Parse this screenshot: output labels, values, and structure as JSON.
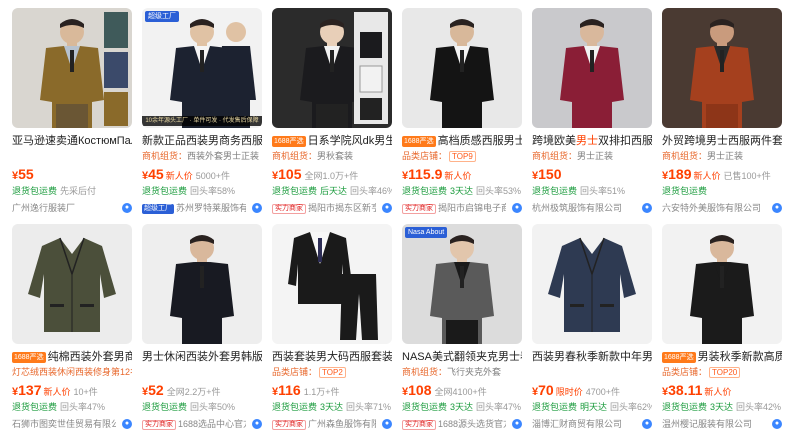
{
  "colors": {
    "price": "#ff4000",
    "green_tag": "#1a9b3c",
    "shop": "#888888",
    "accent_badge": "#ff7a1a"
  },
  "products": [
    {
      "chip": "",
      "title": "亚马逊速卖通КостюмПаль",
      "highlight": "",
      "title2": "",
      "sub_label": "",
      "sub_value": "",
      "sub_top": "",
      "price": "55",
      "newp": "",
      "sold": "",
      "tags": [
        "退货包运费"
      ],
      "repurchase": "先采后付",
      "shop_badge": "",
      "shop": "广州逸行服装厂",
      "img_top": "",
      "img_strip": ""
    },
    {
      "chip": "",
      "title": "新款正品西装男商务西服外",
      "highlight": "",
      "title2": "",
      "sub_label": "商机组货：",
      "sub_value": "西装外套男士正装",
      "sub_top": "",
      "price": "45",
      "newp": "新人价",
      "sold": "5000+件",
      "tags": [
        "退货包运费"
      ],
      "repurchase": "回头率58%",
      "shop_badge": "超级工厂",
      "shop": "苏州罗特莱服饰有限公",
      "img_top": "超级工厂",
      "img_strip": "10余年源头工厂 · 单件可发 · 代发售后保障"
    },
    {
      "chip": "1688严选",
      "title": "日系学院风dk男生制",
      "highlight": "",
      "title2": "",
      "sub_label": "商机组货：",
      "sub_value": "男秋套装",
      "sub_top": "",
      "price": "105",
      "newp": "",
      "sold": "全网1.0万+件",
      "tags": [
        "退货包运费",
        "后天达"
      ],
      "repurchase": "回头率46%",
      "shop_badge": "实力商家",
      "shop": "揭阳市揭东区新亨",
      "img_top": "",
      "img_strip": ""
    },
    {
      "chip": "1688严选",
      "title": "高档质感西服男士韩",
      "highlight": "",
      "title2": "",
      "sub_label": "品类店铺：",
      "sub_value": "",
      "sub_top": "TOP9",
      "price": "115.9",
      "newp": "新人价",
      "sold": "",
      "tags": [
        "退货包运费",
        "3天达"
      ],
      "repurchase": "回头率53%",
      "shop_badge": "实力商家",
      "shop": "揭阳市启锦电子商务",
      "img_top": "",
      "img_strip": ""
    },
    {
      "chip": "",
      "title": "跨境欧美",
      "highlight": "男士",
      "title2": "双排扣西服两",
      "sub_label": "商机组货：",
      "sub_value": "男士正装",
      "sub_top": "",
      "price": "150",
      "newp": "",
      "sold": "",
      "tags": [
        "退货包运费"
      ],
      "repurchase": "回头率51%",
      "shop_badge": "",
      "shop": "杭州极筑服饰有限公司",
      "img_top": "",
      "img_strip": ""
    },
    {
      "chip": "",
      "title": "外贸跨境男士西服两件套休",
      "highlight": "",
      "title2": "",
      "sub_label": "商机组货：",
      "sub_value": "男士正装",
      "sub_top": "",
      "price": "189",
      "newp": "新人价",
      "sold": "已售100+件",
      "tags": [
        "退货包运费"
      ],
      "repurchase": "",
      "shop_badge": "",
      "shop": "六安特外美服饰有限公司",
      "img_top": "",
      "img_strip": ""
    },
    {
      "chip": "1688严选",
      "title": "纯棉西装外套男商务",
      "highlight": "",
      "title2": "",
      "sub_label": "灯芯绒西装休闲西装修身第12名",
      "sub_value": "",
      "sub_top": "",
      "price": "137",
      "newp": "新人价",
      "sold": "10+件",
      "tags": [
        "退货包运费"
      ],
      "repurchase": "回头率47%",
      "shop_badge": "",
      "shop": "石狮市图奕世佳贸易有限公",
      "img_top": "",
      "img_strip": ""
    },
    {
      "chip": "",
      "title": "男士休闲西装外套男韩版潮",
      "highlight": "",
      "title2": "",
      "sub_label": "",
      "sub_value": "",
      "sub_top": "",
      "price": "52",
      "newp": "",
      "sold": "全网2.2万+件",
      "tags": [
        "退货包运费"
      ],
      "repurchase": "回头率50%",
      "shop_badge": "实力商家",
      "shop": "1688选品中心官方",
      "img_top": "",
      "img_strip": ""
    },
    {
      "chip": "",
      "title": "西装套装男大码西服套装男",
      "highlight": "",
      "title2": "",
      "sub_label": "品类店铺：",
      "sub_value": "",
      "sub_top": "TOP2",
      "price": "116",
      "newp": "",
      "sold": "1.1万+件",
      "tags": [
        "退货包运费",
        "3天达"
      ],
      "repurchase": "回头率71%",
      "shop_badge": "实力商家",
      "shop": "广州森鱼服饰有限",
      "img_top": "",
      "img_strip": ""
    },
    {
      "chip": "",
      "title": "NASA美式翻领夹克男士春",
      "highlight": "",
      "title2": "",
      "sub_label": "商机组货：",
      "sub_value": "飞行夹克外套",
      "sub_top": "",
      "price": "108",
      "newp": "",
      "sold": "全网4100+件",
      "tags": [
        "退货包运费",
        "3天达"
      ],
      "repurchase": "回头率47%",
      "shop_badge": "实力商家",
      "shop": "1688源头选货官方",
      "img_top": "Nasa About",
      "img_strip": ""
    },
    {
      "chip": "",
      "title": "西装男春秋季新款中年男士",
      "highlight": "",
      "title2": "",
      "sub_label": "",
      "sub_value": "",
      "sub_top": "",
      "price": "70",
      "newp": "限时价",
      "sold": "4700+件",
      "tags": [
        "退货包运费",
        "明天达"
      ],
      "repurchase": "回头率62%",
      "shop_badge": "",
      "shop": "淄博汇财商贸有限公司",
      "img_top": "",
      "img_strip": ""
    },
    {
      "chip": "1688严选",
      "title": "男装秋季新款高质量中",
      "highlight": "",
      "title2": "",
      "sub_label": "品类店铺：",
      "sub_value": "",
      "sub_top": "TOP20",
      "price": "38.11",
      "newp": "新人价",
      "sold": "",
      "tags": [
        "退货包运费",
        "3天达"
      ],
      "repurchase": "回头率42%",
      "shop_badge": "",
      "shop": "温州樱记服装有限公司",
      "img_top": "",
      "img_strip": ""
    }
  ]
}
